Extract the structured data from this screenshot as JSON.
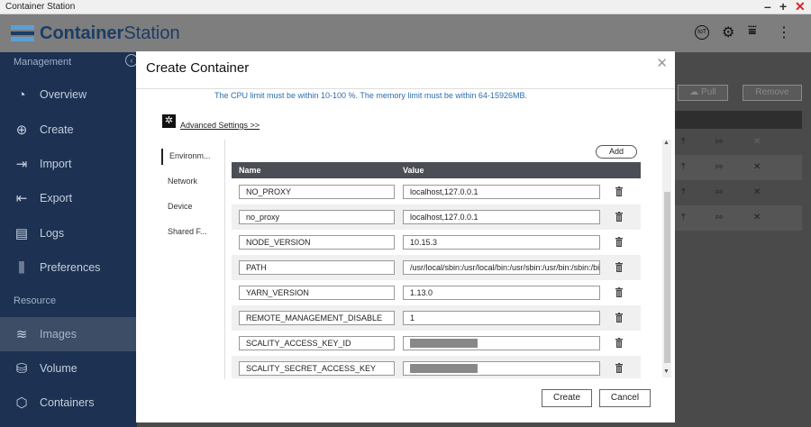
{
  "window": {
    "title": "Container Station",
    "minimize": "–",
    "maximize": "+",
    "close": "✕"
  },
  "app": {
    "brand_bold": "Container",
    "brand_light": "Station",
    "iot_label": "IoT"
  },
  "sidebar": {
    "management_label": "Management",
    "resource_label": "Resource",
    "items": [
      {
        "label": "Overview",
        "icon": "speedometer-icon"
      },
      {
        "label": "Create",
        "icon": "plus-circle-icon"
      },
      {
        "label": "Import",
        "icon": "import-icon"
      },
      {
        "label": "Export",
        "icon": "export-icon"
      },
      {
        "label": "Logs",
        "icon": "document-icon"
      },
      {
        "label": "Preferences",
        "icon": "sliders-icon"
      }
    ],
    "resource_items": [
      {
        "label": "Images",
        "icon": "layers-icon",
        "active": true
      },
      {
        "label": "Volume",
        "icon": "database-icon"
      },
      {
        "label": "Containers",
        "icon": "cube-icon"
      }
    ]
  },
  "background": {
    "pull_label": "Pull",
    "remove_label": "Remove"
  },
  "modal": {
    "title": "Create Container",
    "limit_note": "The CPU limit must be within 10-100 %. The memory limit must be within 64-15926MB.",
    "advanced_label": "Advanced Settings >>",
    "tabs": [
      "Environm...",
      "Network",
      "Device",
      "Shared F..."
    ],
    "add_label": "Add",
    "columns": {
      "name": "Name",
      "value": "Value"
    },
    "env": [
      {
        "name": "NO_PROXY",
        "value": "localhost,127.0.0.1"
      },
      {
        "name": "no_proxy",
        "value": "localhost,127.0.0.1"
      },
      {
        "name": "NODE_VERSION",
        "value": "10.15.3"
      },
      {
        "name": "PATH",
        "value": "/usr/local/sbin:/usr/local/bin:/usr/sbin:/usr/bin:/sbin:/bi"
      },
      {
        "name": "YARN_VERSION",
        "value": "1.13.0"
      },
      {
        "name": "REMOTE_MANAGEMENT_DISABLE",
        "value": "1"
      },
      {
        "name": "SCALITY_ACCESS_KEY_ID",
        "value": ""
      },
      {
        "name": "SCALITY_SECRET_ACCESS_KEY",
        "value": ""
      }
    ],
    "create_label": "Create",
    "cancel_label": "Cancel"
  },
  "colors": {
    "sidebar_bg": "#1d3152",
    "link": "#2c6cb0",
    "header_bg": "#4b4e55"
  }
}
